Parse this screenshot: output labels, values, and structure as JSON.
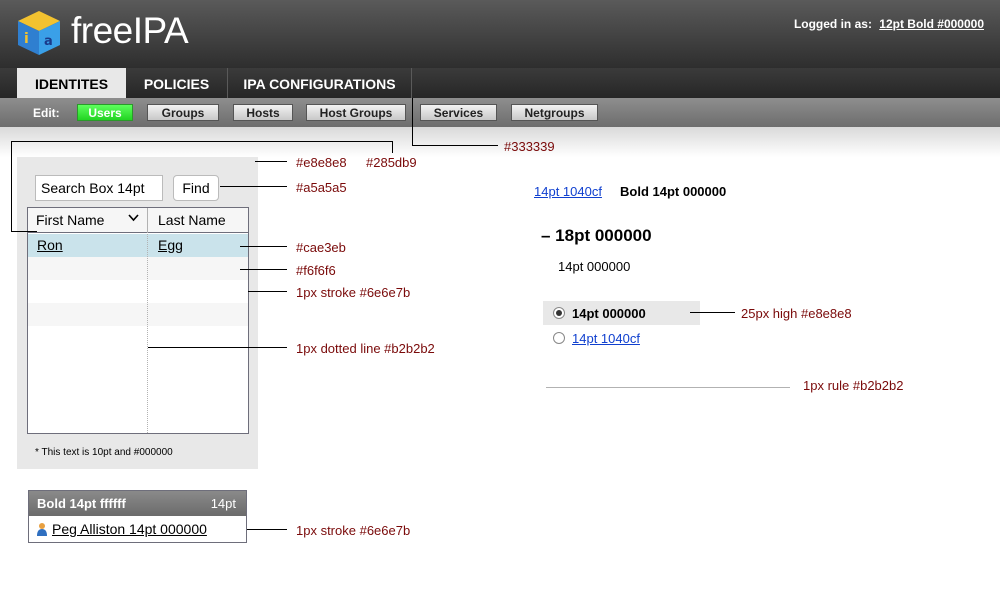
{
  "header": {
    "logo_text": "freeIPA",
    "login_label": "Logged in as:",
    "login_user": "12pt Bold #000000"
  },
  "tabs": [
    {
      "label": "IDENTITES",
      "active": true
    },
    {
      "label": "POLICIES",
      "active": false
    },
    {
      "label": "IPA CONFIGURATIONS",
      "active": false
    }
  ],
  "subnav": {
    "edit_label": "Edit:",
    "items": [
      {
        "label": "Users",
        "active": true
      },
      {
        "label": "Groups",
        "active": false
      },
      {
        "label": "Hosts",
        "active": false
      },
      {
        "label": "Host Groups",
        "active": false
      },
      {
        "label": "Services",
        "active": false
      },
      {
        "label": "Netgroups",
        "active": false
      }
    ]
  },
  "panel": {
    "search_placeholder": "Search Box 14pt",
    "find_label": "Find",
    "columns": [
      "First Name",
      "Last Name"
    ],
    "rows": [
      {
        "first": "Ron",
        "last": "Egg"
      }
    ],
    "note": "* This text is 10pt and #000000"
  },
  "card": {
    "title": "Bold 14pt ffffff",
    "count": "14pt",
    "name": "Peg Alliston 14pt 000000"
  },
  "right": {
    "link": "14pt 1040cf",
    "bold": "Bold 14pt 000000",
    "heading": "– 18pt 000000",
    "plain": "14pt 000000",
    "radio_selected": "14pt 000000",
    "radio_other": "14pt 1040cf"
  },
  "annotations": {
    "tab_border": "#333339",
    "panel_bg": "#e8e8e8",
    "link_color": "#285db9",
    "search_border": "#a5a5a5",
    "selected_row": "#cae3eb",
    "alt_row": "#f6f6f6",
    "stroke": "1px stroke #6e6e7b",
    "dotted": "1px dotted line #b2b2b2",
    "radio_bg": "25px high #e8e8e8",
    "rule": "1px rule #b2b2b2",
    "card_stroke": "1px stroke #6e6e7b"
  },
  "colors": {
    "active_green": "#2bd92b",
    "link_blue": "#1040cf",
    "annotation_red": "#7a0a0a",
    "selected_row": "#cae3eb",
    "alt_row": "#f6f6f6"
  }
}
